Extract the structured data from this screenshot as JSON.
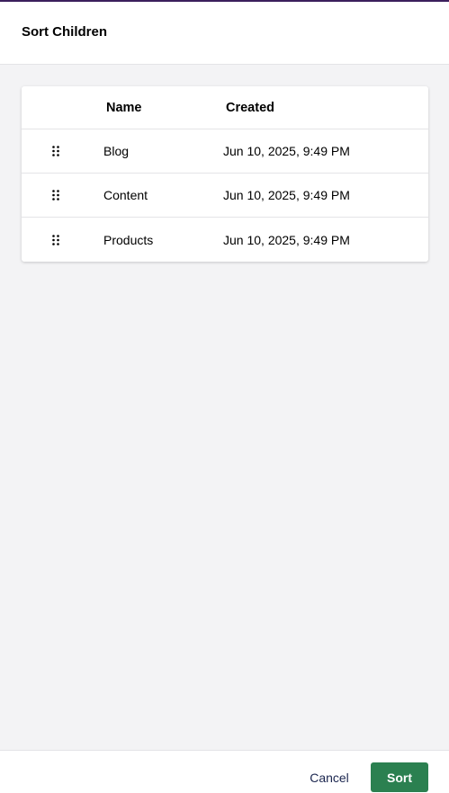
{
  "header": {
    "title": "Sort Children"
  },
  "table": {
    "columns": {
      "name": "Name",
      "created": "Created"
    },
    "rows": [
      {
        "name": "Blog",
        "created": "Jun 10, 2025, 9:49 PM",
        "icon": "drag-handle-icon"
      },
      {
        "name": "Content",
        "created": "Jun 10, 2025, 9:49 PM",
        "icon": "drag-handle-icon"
      },
      {
        "name": "Products",
        "created": "Jun 10, 2025, 9:49 PM",
        "icon": "drag-handle-icon"
      }
    ]
  },
  "footer": {
    "cancel_label": "Cancel",
    "sort_label": "Sort"
  },
  "colors": {
    "accent_top_border": "#3b1f5c",
    "primary_button": "#2b8050",
    "background": "#f3f3f5"
  }
}
